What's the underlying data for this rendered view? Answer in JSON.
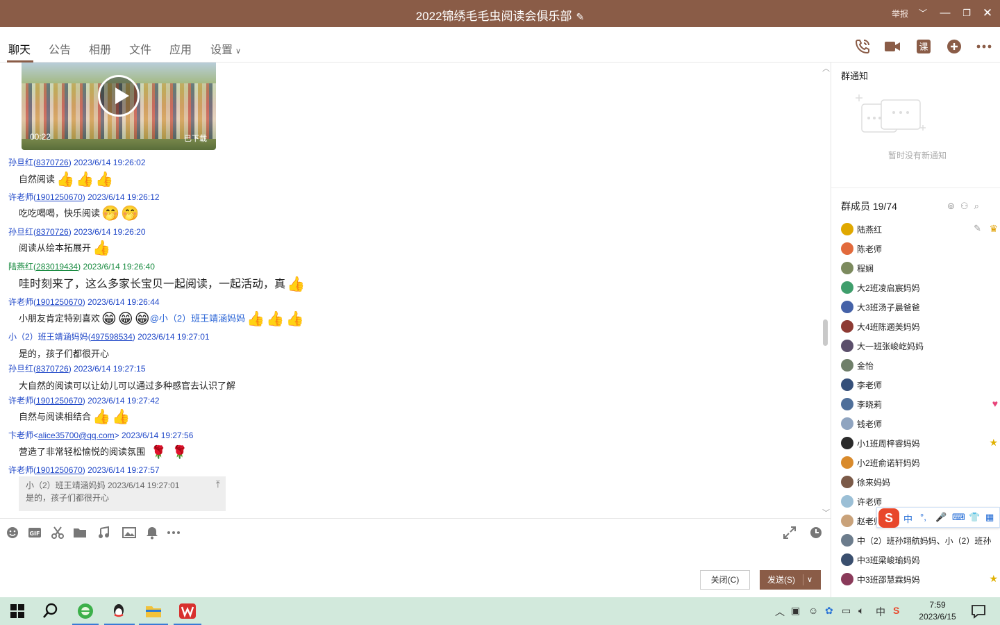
{
  "window": {
    "title": "2022锦绣毛毛虫阅读会俱乐部",
    "report": "举报"
  },
  "tabs": [
    {
      "label": "聊天"
    },
    {
      "label": "公告"
    },
    {
      "label": "相册"
    },
    {
      "label": "文件"
    },
    {
      "label": "应用"
    },
    {
      "label": "设置"
    }
  ],
  "video": {
    "duration": "00:22",
    "status": "已下载"
  },
  "messages": [
    {
      "sender": "孙旦红",
      "qq": "8370726",
      "time": "2023/6/14 19:26:02",
      "text": "自然阅读"
    },
    {
      "sender": "许老师",
      "qq": "1901250670",
      "time": "2023/6/14 19:26:12",
      "text": "吃吃喝喝，快乐阅读"
    },
    {
      "sender": "孙旦红",
      "qq": "8370726",
      "time": "2023/6/14 19:26:20",
      "text": "阅读从绘本拓展开"
    },
    {
      "sender": "陆燕红",
      "qq": "283019434",
      "time": "2023/6/14 19:26:40",
      "text": "哇时刻来了，这么多家长宝贝一起阅读，一起活动，真"
    },
    {
      "sender": "许老师",
      "qq": "1901250670",
      "time": "2023/6/14 19:26:44",
      "text": "小朋友肯定特别喜欢",
      "mention": "@小（2）班王靖涵妈妈"
    },
    {
      "sender": "小（2）班王靖涵妈妈",
      "qq": "497598534",
      "time": "2023/6/14 19:27:01",
      "text": "是的，孩子们都很开心"
    },
    {
      "sender": "孙旦红",
      "qq": "8370726",
      "time": "2023/6/14 19:27:15",
      "text": "大自然的阅读可以让幼儿可以通过多种感官去认识了解"
    },
    {
      "sender": "许老师",
      "qq": "1901250670",
      "time": "2023/6/14 19:27:42",
      "text": "自然与阅读相结合"
    },
    {
      "sender": "卞老师",
      "qq": "alice35700@qq.com",
      "time": "2023/6/14 19:27:56",
      "text": "营造了非常轻松愉悦的阅读氛围"
    },
    {
      "sender": "许老师",
      "qq": "1901250670",
      "time": "2023/6/14 19:27:57"
    }
  ],
  "quote": {
    "header": "小（2）班王靖涵妈妈   2023/6/14 19:27:01",
    "text": "是的，孩子们都很开心"
  },
  "buttons": {
    "close": "关闭(C)",
    "send": "发送(S)"
  },
  "right": {
    "notice_title": "群通知",
    "notice_empty": "暂时没有新通知",
    "members_title": "群成员 19/74",
    "members": [
      {
        "name": "陆燕红",
        "color": "#e0a800"
      },
      {
        "name": "陈老师",
        "color": "#e26a3c"
      },
      {
        "name": "程娴",
        "color": "#7c8a5e"
      },
      {
        "name": "大2班凌启宸妈妈",
        "color": "#3f9e6c"
      },
      {
        "name": "大3班汤子晨爸爸",
        "color": "#4562a8"
      },
      {
        "name": "大4班陈逦美妈妈",
        "color": "#8d3a33"
      },
      {
        "name": "大一班张峻屹妈妈",
        "color": "#5b4f6b"
      },
      {
        "name": "金怡",
        "color": "#6f7f6a"
      },
      {
        "name": "李老师",
        "color": "#36507a"
      },
      {
        "name": "李晓莉",
        "color": "#4f6f9a"
      },
      {
        "name": "钱老师",
        "color": "#8fa4c0"
      },
      {
        "name": "小1班周梓睿妈妈",
        "color": "#2a2a2a"
      },
      {
        "name": "小2班俞诺轩妈妈",
        "color": "#d98a2b"
      },
      {
        "name": "徐来妈妈",
        "color": "#7b5a48"
      },
      {
        "name": "许老师",
        "color": "#9bbfd6"
      },
      {
        "name": "赵老师",
        "color": "#c9a27a"
      },
      {
        "name": "中（2）班孙翊航妈妈、小（2）班孙",
        "color": "#6c7c8c"
      },
      {
        "name": "中3班梁峻瑜妈妈",
        "color": "#3a4f6e"
      },
      {
        "name": "中3班邵慧霖妈妈",
        "color": "#8a3a5a"
      }
    ]
  },
  "ime": {
    "items": [
      "中",
      "°,",
      "🎤",
      "⌨",
      "👕",
      "▦"
    ]
  },
  "clock": {
    "time": "7:59",
    "date": "2023/6/15"
  }
}
